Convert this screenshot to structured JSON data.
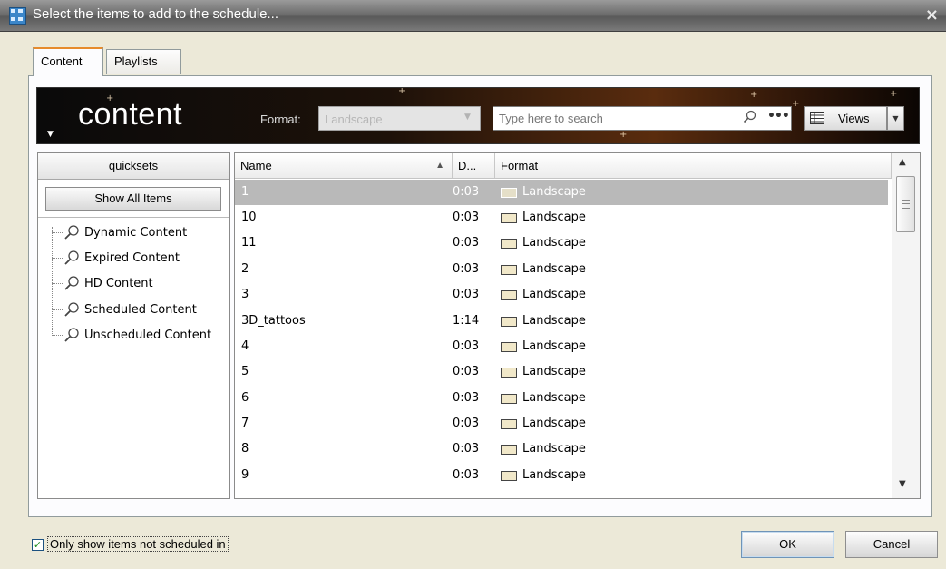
{
  "window": {
    "title": "Select the items to add to the schedule...",
    "close_glyph": "×"
  },
  "tabs": [
    {
      "label": "Content",
      "active": true
    },
    {
      "label": "Playlists",
      "active": false
    }
  ],
  "header": {
    "title": "content",
    "format_label": "Format:",
    "format_value": "Landscape",
    "search_placeholder": "Type here to search",
    "more_glyph": "•••",
    "views_label": "Views"
  },
  "quicksets": {
    "header": "quicksets",
    "show_all_label": "Show All Items",
    "items": [
      "Dynamic Content",
      "Expired Content",
      "HD Content",
      "Scheduled Content",
      "Unscheduled Content"
    ]
  },
  "table": {
    "columns": [
      "Name",
      "D...",
      "Format"
    ],
    "sort": {
      "column": "Name",
      "direction": "ascending"
    },
    "rows": [
      {
        "name": "1",
        "duration": "0:03",
        "format": "Landscape",
        "selected": true
      },
      {
        "name": "10",
        "duration": "0:03",
        "format": "Landscape"
      },
      {
        "name": "11",
        "duration": "0:03",
        "format": "Landscape"
      },
      {
        "name": "2",
        "duration": "0:03",
        "format": "Landscape"
      },
      {
        "name": "3",
        "duration": "0:03",
        "format": "Landscape"
      },
      {
        "name": "3D_tattoos",
        "duration": "1:14",
        "format": "Landscape"
      },
      {
        "name": "4",
        "duration": "0:03",
        "format": "Landscape"
      },
      {
        "name": "5",
        "duration": "0:03",
        "format": "Landscape"
      },
      {
        "name": "6",
        "duration": "0:03",
        "format": "Landscape"
      },
      {
        "name": "7",
        "duration": "0:03",
        "format": "Landscape"
      },
      {
        "name": "8",
        "duration": "0:03",
        "format": "Landscape"
      },
      {
        "name": "9",
        "duration": "0:03",
        "format": "Landscape"
      }
    ]
  },
  "footer": {
    "checkbox_label": "Only show items not scheduled in",
    "checkbox_checked": true,
    "ok_label": "OK",
    "cancel_label": "Cancel"
  },
  "colors": {
    "title_bar": "#6e6e6e",
    "header_accent": "#5a2c0e",
    "selected_row": "#b9b9b9",
    "tab_accent": "#e68b2c"
  },
  "icons": [
    "app-icon",
    "close-icon",
    "search-icon",
    "more-icon",
    "views-grid-icon",
    "chevron-down-icon",
    "magnifier-icon",
    "landscape-format-icon",
    "sort-ascending-icon",
    "scroll-up-icon",
    "scroll-down-icon",
    "checkbox-check-icon"
  ]
}
